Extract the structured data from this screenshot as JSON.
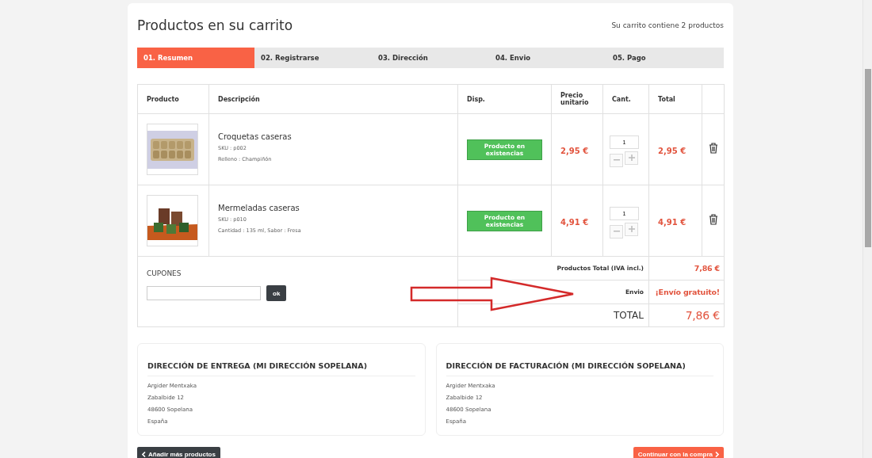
{
  "title": "Productos en su carrito",
  "cart_count": "Su carrito contiene 2 productos",
  "steps": [
    {
      "label": "01. Resumen",
      "selected": true
    },
    {
      "label": "02. Registrarse",
      "selected": false
    },
    {
      "label": "03. Dirección",
      "selected": false
    },
    {
      "label": "04. Envio",
      "selected": false
    },
    {
      "label": "05. Pago",
      "selected": false
    }
  ],
  "table": {
    "columns": [
      "Producto",
      "Descripción",
      "Disp.",
      "Precio unitario",
      "Cant.",
      "Total"
    ],
    "rows": [
      {
        "name": "Croquetas caseras",
        "sku": "SKU : p002",
        "attributes": "Relleno : Champiñón",
        "availability": "Producto en existencias",
        "unit_price": "2,95 €",
        "quantity": "1",
        "total": "2,95 €"
      },
      {
        "name": "Mermeladas caseras",
        "sku": "SKU : p010",
        "attributes": "Cantidad : 135 ml, Sabor : Fresa",
        "availability": "Producto en existencias",
        "unit_price": "4,91 €",
        "quantity": "1",
        "total": "4,91 €"
      }
    ],
    "coupons": {
      "label": "CUPONES",
      "button": "ok"
    },
    "summary": [
      {
        "label": "Productos Total (IVA incl.)",
        "value": "7,86 €",
        "kind": "normal"
      },
      {
        "label": "Envio",
        "value": "¡Envío gratuito!",
        "kind": "normal"
      },
      {
        "label": "TOTAL",
        "value": "7,86 €",
        "kind": "grand"
      }
    ]
  },
  "addresses": [
    {
      "title": "DIRECCIÓN DE ENTREGA (MI DIRECCIÓN SOPELANA)",
      "lines": [
        "Argider Mentxaka",
        "Zabalbide 12",
        "48600 Sopelana",
        "España"
      ]
    },
    {
      "title": "DIRECCIÓN DE FACTURACIÓN (MI DIRECCIÓN SOPELANA)",
      "lines": [
        "Argider Mentxaka",
        "Zabalbide 12",
        "48600 Sopelana",
        "España"
      ]
    }
  ],
  "buttons": {
    "back": "Añadir más productos",
    "next": "Continuar con la compra"
  }
}
